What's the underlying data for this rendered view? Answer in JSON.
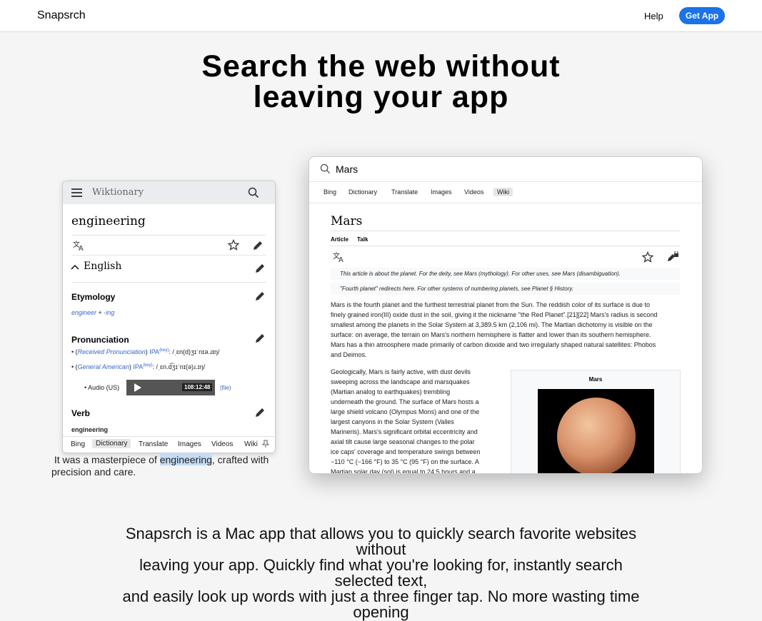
{
  "nav": {
    "brand": "Snapsrch",
    "help": "Help",
    "get_app": "Get App"
  },
  "hero": {
    "line1": "Search the web without",
    "line2": "leaving your app"
  },
  "phone": {
    "header_title": "Wiktionary",
    "word": "engineering",
    "language": "English",
    "etymology_heading": "Etymology",
    "etymology_link1": "engineer",
    "etymology_plus": " + ",
    "etymology_link2": "-ing",
    "pronunciation_heading": "Pronunciation",
    "pron1_open": "(",
    "pron1_link": "Received Pronunciation",
    "pron1_close": ") ",
    "pron1_ipa": "IPA",
    "pron1_key": "(key)",
    "pron1_value": ": /ˌɛn(d)ʒɪˈnɪə.ɹɪŋ/",
    "pron2_open": "(",
    "pron2_link": "General American",
    "pron2_close": ") ",
    "pron2_ipa": "IPA",
    "pron2_key": "(key)",
    "pron2_value": ": /ˌɛn.d͡ʒɪˈnɪ(ə)ɹ.ɪŋ/",
    "audio_label": "Audio (US)",
    "audio_time": "108:12:48",
    "audio_file": "(file)",
    "verb_heading": "Verb",
    "verb_word": "engineering",
    "tabs": [
      "Bing",
      "Dictionary",
      "Translate",
      "Images",
      "Videos",
      "Wiki"
    ],
    "selected_tab": "Dictionary"
  },
  "caption": {
    "before": "It was a masterpiece of ",
    "highlight": "engineering",
    "after": ", crafted with precision and care."
  },
  "window": {
    "query": "Mars",
    "tabs": [
      "Bing",
      "Dictionary",
      "Translate",
      "Images",
      "Videos",
      "Wiki"
    ],
    "selected_tab": "Wiki",
    "title": "Mars",
    "nav_article": "Article",
    "nav_talk": "Talk",
    "hatnote1": "This article is about the planet. For the deity, see Mars (mythology). For other uses, see Mars (disambiguation).",
    "hatnote2": "\"Fourth planet\" redirects here. For other systems of numbering planets, see Planet § History.",
    "para1_lines": [
      "Mars is the fourth planet and the furthest terrestrial planet from the Sun. The reddish color of its surface is due to",
      "finely grained iron(III) oxide dust in the soil, giving it the nickname \"the Red Planet\".[21][22] Mars's radius is second",
      "smallest among the planets in the Solar System at 3,389.5 km (2,106 mi). The Martian dichotomy is visible on the",
      "surface: on average, the terrain on Mars's northern hemisphere is flatter and lower than its southern hemisphere.",
      "Mars has a thin atmosphere made primarily of carbon dioxide and two irregularly shaped natural satellites: Phobos",
      "and Deimos."
    ],
    "para2_lines": [
      "Geologically, Mars is fairly active, with dust devils",
      "sweeping across the landscape and marsquakes",
      "(Martian analog to earthquakes) trembling",
      "underneath the ground. The surface of Mars hosts a",
      "large shield volcano (Olympus Mons) and one of the",
      "largest canyons in the Solar System (Valles",
      "Marineris). Mars's significant orbital eccentricity and",
      "axial tilt cause large seasonal changes to the polar",
      "ice caps' coverage and temperature swings between",
      "−110 °C (−166 °F) to 35 °C (95 °F) on the surface. A",
      "Martian solar day (sol) is equal to 24.5 hours and a"
    ],
    "infobox_title": "Mars"
  },
  "bottom": {
    "lines": [
      "Snapsrch is a Mac app that allows you to quickly search favorite websites without",
      "leaving your app. Quickly find what you're looking for, instantly search selected text,",
      "and easily look up words with just a three finger tap. No more wasting time opening"
    ]
  },
  "colors": {
    "accent": "#1a73e8",
    "link": "#3366cc",
    "selection": "#c4dcf6"
  },
  "icons": [
    "menu-icon",
    "search-icon",
    "translate-icon",
    "star-icon",
    "pencil-icon",
    "chevron-up-icon",
    "play-icon",
    "pin-icon",
    "edit-lock-icon"
  ]
}
